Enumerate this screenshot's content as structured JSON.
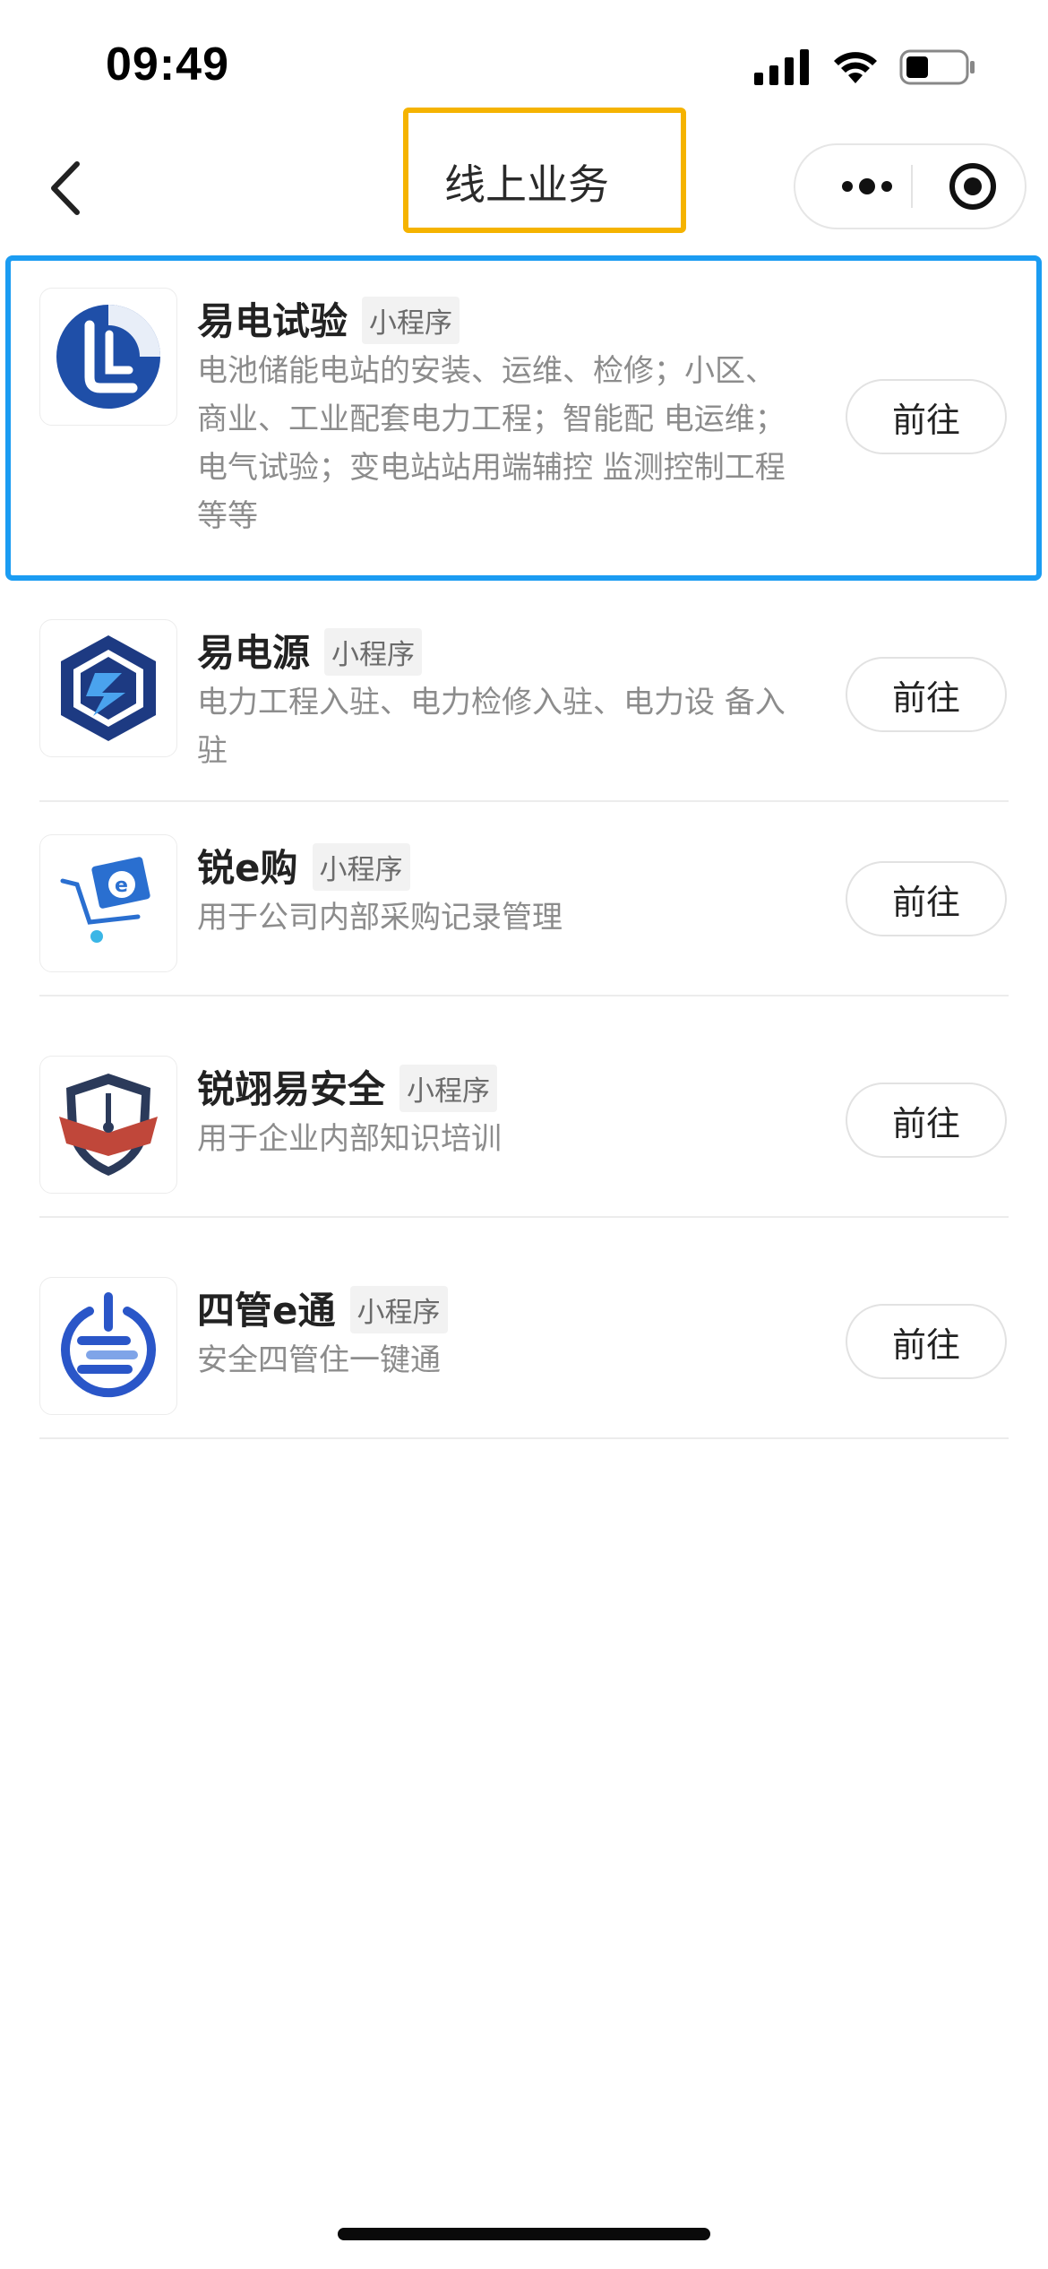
{
  "status_bar": {
    "time": "09:49"
  },
  "nav": {
    "title": "线上业务"
  },
  "items": [
    {
      "name": "易电试验",
      "tag": "小程序",
      "desc": "电池储能电站的安装、运维、检修；小区、商业、工业配套电力工程；智能配 电运维；电气试验；变电站站用端辅控 监测控制工程等等",
      "button": "前往",
      "icon": "yidian-shiyan-logo"
    },
    {
      "name": "易电源",
      "tag": "小程序",
      "desc": "电力工程入驻、电力检修入驻、电力设 备入驻",
      "button": "前往",
      "icon": "yidianyuan-logo"
    },
    {
      "name": "锐e购",
      "tag": "小程序",
      "desc": "用于公司内部采购记录管理",
      "button": "前往",
      "icon": "cart-e-logo"
    },
    {
      "name": "锐翊易安全",
      "tag": "小程序",
      "desc": "用于企业内部知识培训",
      "button": "前往",
      "icon": "shield-book-logo"
    },
    {
      "name": "四管e通",
      "tag": "小程序",
      "desc": "安全四管住一键通",
      "button": "前往",
      "icon": "power-e-logo"
    }
  ],
  "colors": {
    "title_highlight": "#f5b300",
    "item_highlight": "#1b9cf2",
    "brand_blue": "#1f4fa8"
  }
}
